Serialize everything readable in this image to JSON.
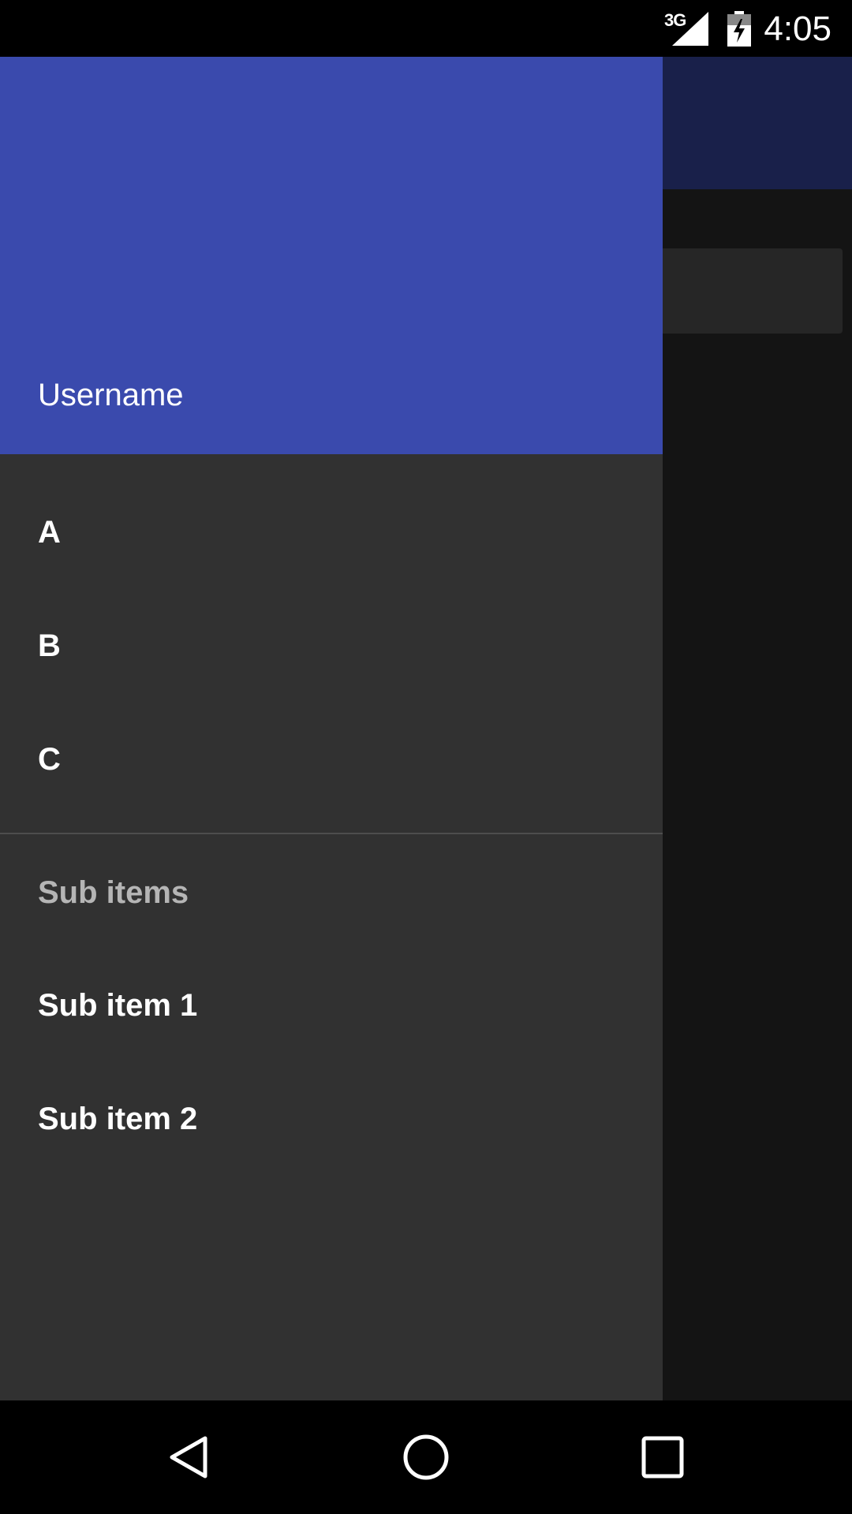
{
  "status_bar": {
    "network": "3G",
    "time": "4:05"
  },
  "drawer": {
    "header": {
      "username": "Username",
      "color": "#3a4aad"
    },
    "items": [
      {
        "label": "A"
      },
      {
        "label": "B"
      },
      {
        "label": "C"
      }
    ],
    "subheader": "Sub items",
    "sub_items": [
      {
        "label": "Sub item 1"
      },
      {
        "label": "Sub item 2"
      }
    ]
  },
  "nav_bar": {
    "buttons": [
      "back-icon",
      "home-icon",
      "recents-icon"
    ]
  }
}
